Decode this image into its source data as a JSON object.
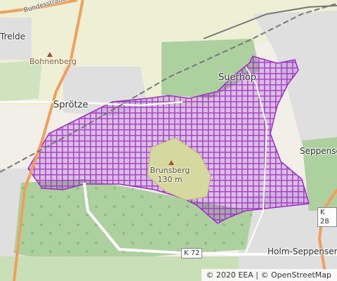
{
  "map": {
    "places": {
      "trelde": "Trelde",
      "bohnenberg": "Bohnenberg",
      "sproetze": "Sprötze",
      "suerhop": "Suerhop",
      "seppensen": "Seppensen",
      "holm_seppensen": "Holm-Seppensen"
    },
    "peak": {
      "name": "Brunsberg",
      "elevation": "130 m"
    },
    "roads": {
      "bundesstrasse": "Bundesstraße",
      "k72": "K 72",
      "k28": "K 28"
    },
    "attribution": "© 2020 EEA | © OpenStreetMap",
    "colors": {
      "background": "#f2efe9",
      "farmland": "#eef0d5",
      "forest": "#add19e",
      "residential": "#e0dfdf",
      "heath": "#d6d99f",
      "protected_area": "#9b30c8",
      "road_major": "#f0a05a",
      "rail": "#888888"
    }
  }
}
